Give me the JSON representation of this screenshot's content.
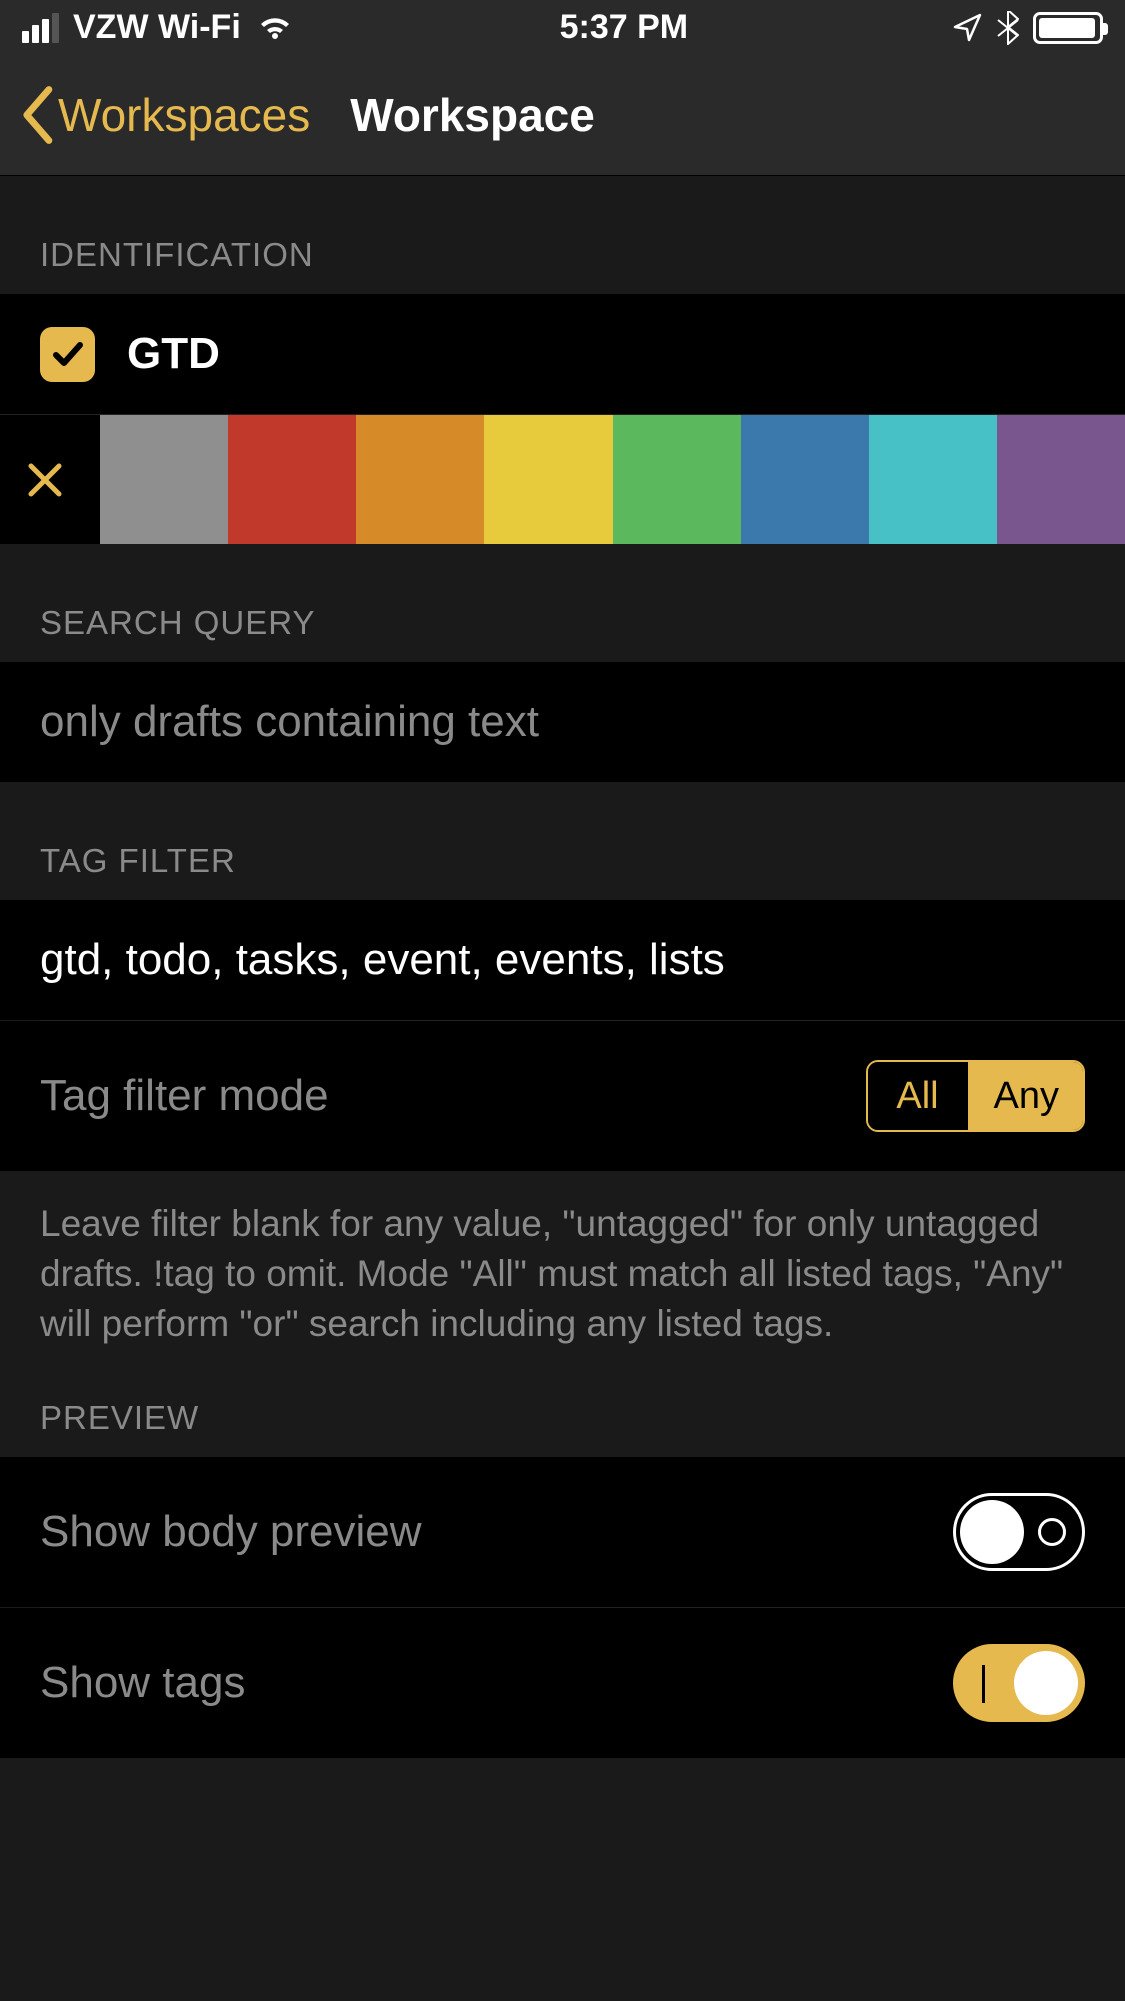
{
  "status": {
    "carrier": "VZW Wi-Fi",
    "time": "5:37 PM"
  },
  "nav": {
    "back_label": "Workspaces",
    "title": "Workspace"
  },
  "identification": {
    "header": "Identification",
    "name": "GTD",
    "colors": [
      "#8f8f8f",
      "#c0392b",
      "#d68a28",
      "#e7cb3c",
      "#5cb85c",
      "#3b78ab",
      "#47c1c6",
      "#7a568f"
    ]
  },
  "search": {
    "header": "Search Query",
    "placeholder": "only drafts containing text",
    "value": ""
  },
  "tagfilter": {
    "header": "Tag Filter",
    "value": "gtd, todo, tasks, event, events, lists",
    "mode_label": "Tag filter mode",
    "mode_options": {
      "all": "All",
      "any": "Any"
    },
    "mode_selected": "Any",
    "footer": "Leave filter blank for any value, \"untagged\" for only untagged drafts. !tag to omit. Mode \"All\" must match all listed tags, \"Any\" will perform \"or\" search including any listed tags."
  },
  "preview": {
    "header": "Preview",
    "show_body_label": "Show body preview",
    "show_body": false,
    "show_tags_label": "Show tags",
    "show_tags": true
  }
}
